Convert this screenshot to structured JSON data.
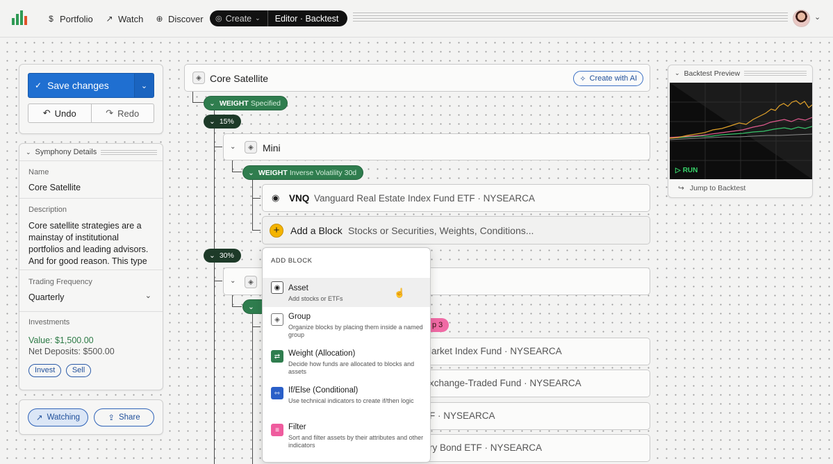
{
  "nav": {
    "items": [
      {
        "label": "Portfolio",
        "icon": "dollar-circle-icon"
      },
      {
        "label": "Watch",
        "icon": "trend-icon"
      },
      {
        "label": "Discover",
        "icon": "compass-icon"
      }
    ],
    "create_label": "Create",
    "editor_label": "Editor · Backtest",
    "brand_color": "#2f9a55"
  },
  "actions": {
    "save_label": "Save changes",
    "undo_label": "Undo",
    "redo_label": "Redo",
    "accent": "#1f6fd1"
  },
  "details": {
    "header": "Symphony Details",
    "name_label": "Name",
    "name_value": "Core Satellite",
    "description_label": "Description",
    "description_value": "Core satellite strategies are a mainstay of institutional portfolios and leading advisors. And for good reason. This type",
    "trading_label": "Trading Frequency",
    "trading_value": "Quarterly",
    "investments_label": "Investments",
    "value_text": "Value: $1,500.00",
    "deposits_text": "Net Deposits: $500.00",
    "invest_label": "Invest",
    "sell_label": "Sell"
  },
  "watch": {
    "watching_label": "Watching",
    "share_label": "Share"
  },
  "tree": {
    "root_title": "Core Satellite",
    "create_ai_label": "Create with AI",
    "weight1": {
      "bold": "WEIGHT",
      "rest": "Specified"
    },
    "pct1": "15%",
    "mini_title": "Mini",
    "weight2": {
      "bold": "WEIGHT",
      "rest": "Inverse Volatility 30d"
    },
    "asset1": {
      "ticker": "VNQ",
      "name": "Vanguard Real Estate Index Fund ETF · NYSEARCA"
    },
    "add_block": {
      "label": "Add a Block",
      "hint": "Stocks or Securities, Weights, Conditions..."
    },
    "pct2": "30%",
    "pink_label": "p 3",
    "row_a": "larket Index Fund · NYSEARCA",
    "row_b": "xchange-Traded Fund · NYSEARCA",
    "row_c": "F · NYSEARCA",
    "row_d": "ry Bond ETF · NYSEARCA"
  },
  "menu": {
    "title": "ADD BLOCK",
    "items": [
      {
        "title": "Asset",
        "desc": "Add stocks or ETFs",
        "icon": "radio-target-icon",
        "color": "#ffffff"
      },
      {
        "title": "Group",
        "desc": "Organize blocks by placing them inside a named group",
        "icon": "layers-icon",
        "color": "#ffffff"
      },
      {
        "title": "Weight (Allocation)",
        "desc": "Decide how funds are allocated to blocks and assets",
        "icon": "weight-icon",
        "color": "#2f7d4e"
      },
      {
        "title": "If/Else (Conditional)",
        "desc": "Use technical indicators to create if/then logic",
        "icon": "branch-icon",
        "color": "#2a5fc8"
      },
      {
        "title": "Filter",
        "desc": "Sort and filter assets by their attributes and other indicators",
        "icon": "filter-icon",
        "color": "#ef5c9e"
      }
    ]
  },
  "preview": {
    "header": "Backtest Preview",
    "run_label": "RUN",
    "jump_label": "Jump to Backtest",
    "series_colors": [
      "#e0a12a",
      "#e05a8e",
      "#38c46b",
      "#8a8a8a"
    ]
  }
}
